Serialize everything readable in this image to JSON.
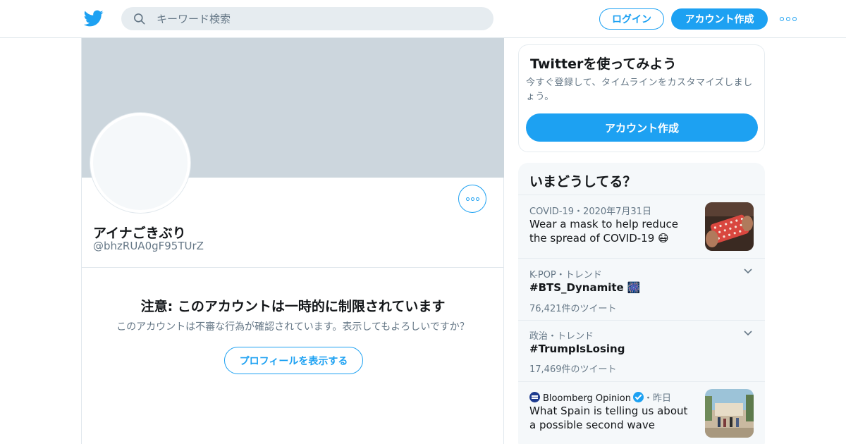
{
  "header": {
    "search_placeholder": "キーワード検索",
    "login_label": "ログイン",
    "signup_label": "アカウント作成"
  },
  "colors": {
    "accent": "#1da1f2",
    "banner": "#ccd6dd",
    "muted_text": "#657786"
  },
  "profile": {
    "display_name": "アイナごきぶり",
    "handle": "@bhzRUA0gF95TUrZ"
  },
  "warning": {
    "title": "注意: このアカウントは一時的に制限されています",
    "text": "このアカウントは不審な行為が確認されています。表示してもよろしいですか？",
    "button_label": "プロフィールを表示する"
  },
  "signup_card": {
    "title": "Twitterを使ってみよう",
    "description": "今すぐ登録して、タイムラインをカスタマイズしましょう。",
    "button_label": "アカウント作成"
  },
  "trends": {
    "heading": "いまどうしてる？",
    "items": [
      {
        "meta": "COVID-19・2020年7月31日",
        "title": "Wear a mask to help reduce the spread of COVID-19 😷",
        "has_image": true,
        "image_icon": "red-mask-photo"
      },
      {
        "meta": "K-POP・トレンド",
        "title": "#BTS_Dynamite 🎆",
        "count": "76,421件のツイート"
      },
      {
        "meta": "政治・トレンド",
        "title": "#TrumpIsLosing",
        "count": "17,469件のツイート"
      },
      {
        "source": "Bloomberg Opinion",
        "time": "・昨日",
        "title": "What Spain is telling us about a possible second wave",
        "has_image": true,
        "image_icon": "street-scene-photo"
      }
    ]
  }
}
